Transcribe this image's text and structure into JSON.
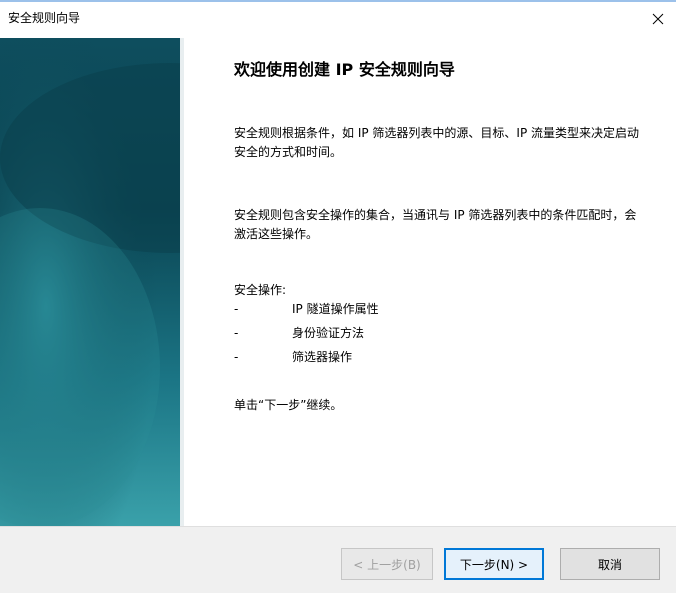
{
  "window": {
    "title": "安全规则向导"
  },
  "wizard": {
    "heading": "欢迎使用创建 IP 安全规则向导",
    "paragraph1": "安全规则根据条件，如 IP 筛选器列表中的源、目标、IP 流量类型来决定启动安全的方式和时间。",
    "paragraph2": "安全规则包含安全操作的集合，当通讯与 IP 筛选器列表中的条件匹配时，会激活这些操作。",
    "operations_title": "安全操作:",
    "operations": [
      {
        "dash": "-",
        "label": "IP 隧道操作属性"
      },
      {
        "dash": "-",
        "label": "身份验证方法"
      },
      {
        "dash": "-",
        "label": "筛选器操作"
      }
    ],
    "continue_text": "单击“下一步”继续。"
  },
  "buttons": {
    "back": "< 上一步(B)",
    "next": "下一步(N) >",
    "cancel": "取消"
  },
  "colors": {
    "banner_dark": "#0b4a58",
    "banner_light": "#2a8e9a",
    "focus_border": "#0078d7"
  },
  "icons": {
    "close": "close-icon"
  }
}
